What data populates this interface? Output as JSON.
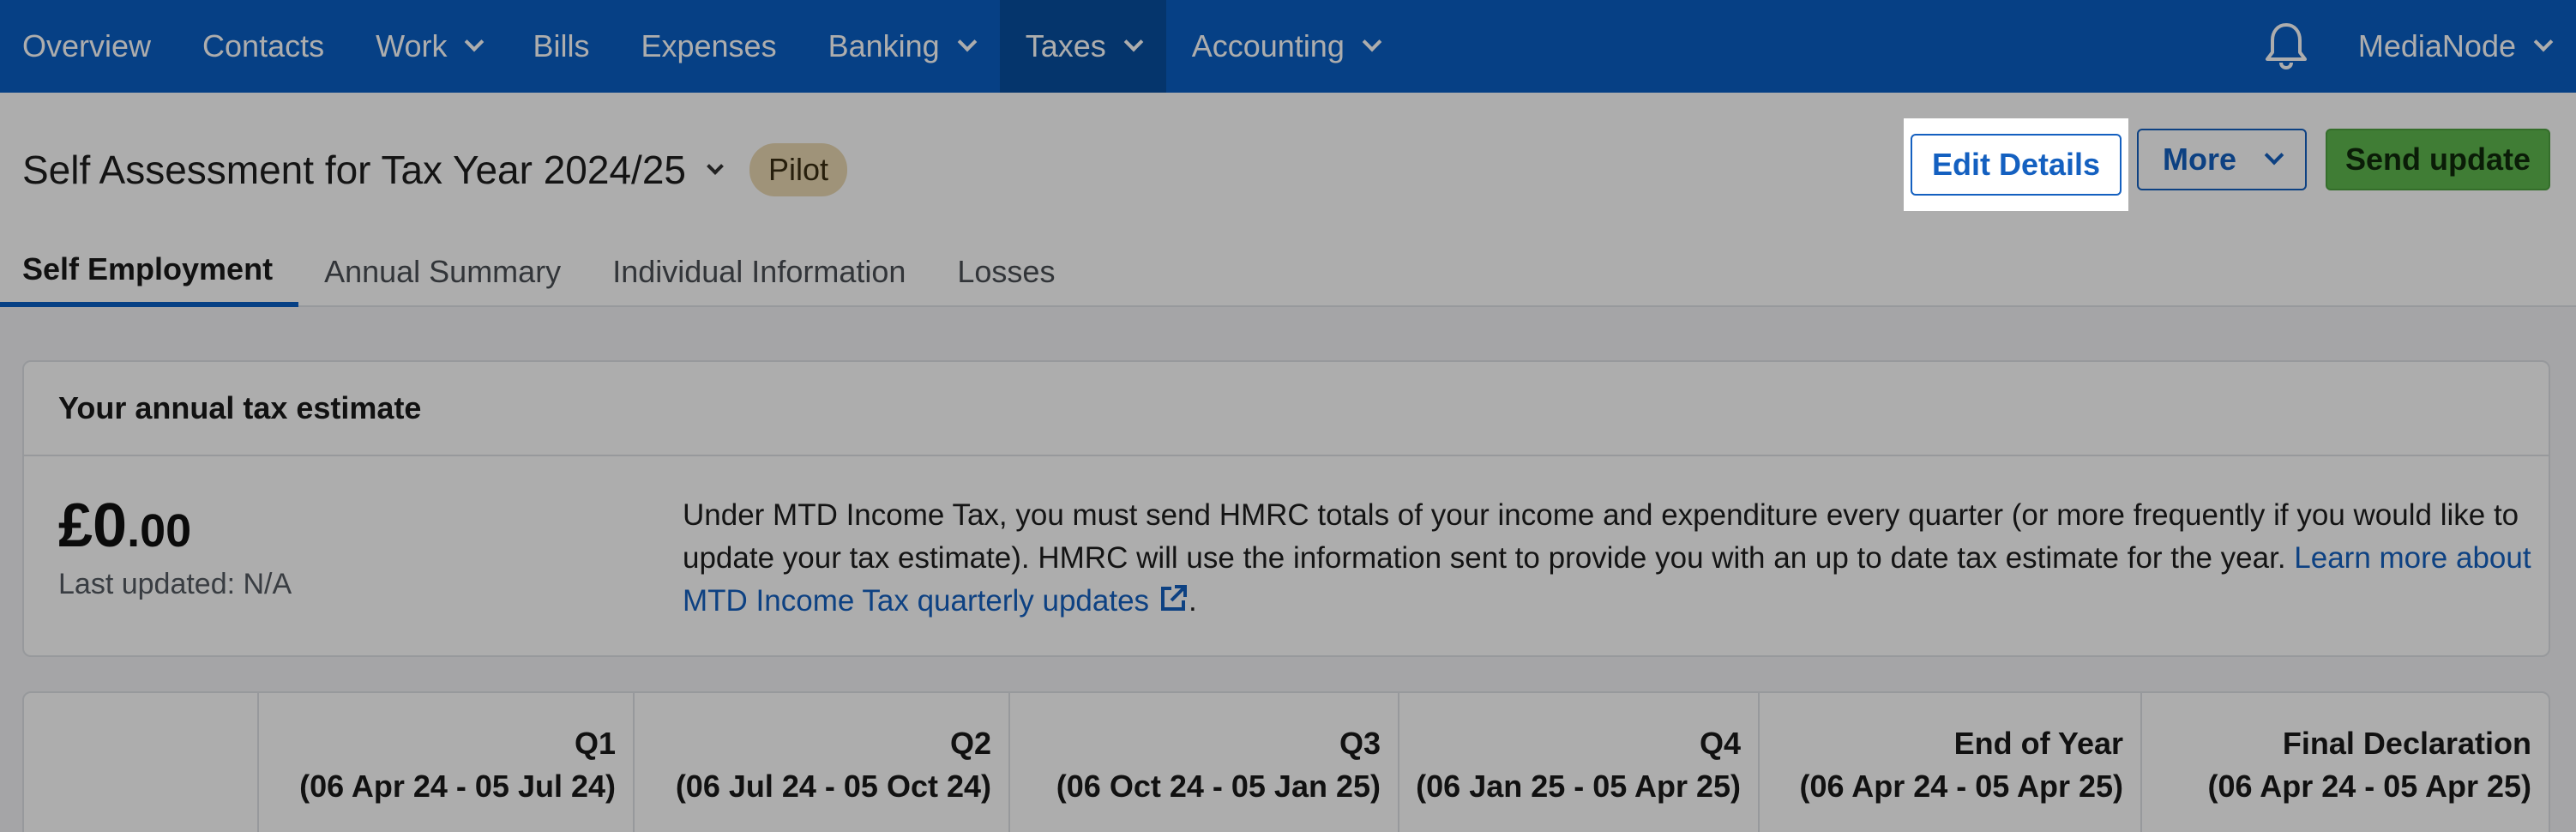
{
  "nav": {
    "items": [
      {
        "label": "Overview",
        "dropdown": false
      },
      {
        "label": "Contacts",
        "dropdown": false
      },
      {
        "label": "Work",
        "dropdown": true
      },
      {
        "label": "Bills",
        "dropdown": false
      },
      {
        "label": "Expenses",
        "dropdown": false
      },
      {
        "label": "Banking",
        "dropdown": true
      },
      {
        "label": "Taxes",
        "dropdown": true
      },
      {
        "label": "Accounting",
        "dropdown": true
      }
    ],
    "active": "Taxes",
    "org_name": "MediaNode",
    "bell_icon": "bell-icon"
  },
  "header": {
    "title": "Self Assessment for Tax Year 2024/25",
    "badge": "Pilot",
    "edit_label": "Edit Details",
    "more_label": "More",
    "send_label": "Send update"
  },
  "tabs": [
    {
      "label": "Self Employment"
    },
    {
      "label": "Annual Summary"
    },
    {
      "label": "Individual Information"
    },
    {
      "label": "Losses"
    }
  ],
  "estimate": {
    "heading": "Your annual tax estimate",
    "amount_main": "£0",
    "amount_pence": ".00",
    "last_updated": "Last updated: N/A",
    "description": "Under MTD Income Tax, you must send HMRC totals of your income and expenditure every quarter (or more frequently if you would like to update your tax estimate). HMRC will use the information sent to provide you with an up to date tax estimate for the year. ",
    "link_text": "Learn more about MTD Income Tax quarterly updates",
    "after_link": "."
  },
  "quarters": [
    {
      "name": "Q1",
      "range": "(06 Apr 24 - 05 Jul 24)"
    },
    {
      "name": "Q2",
      "range": "(06 Jul 24 - 05 Oct 24)"
    },
    {
      "name": "Q3",
      "range": "(06 Oct 24 - 05 Jan 25)"
    },
    {
      "name": "Q4",
      "range": "(06 Jan 25 - 05 Apr 25)"
    },
    {
      "name": "End of Year",
      "range": "(06 Apr 24 - 05 Apr 25)"
    },
    {
      "name": "Final Declaration",
      "range": "(06 Apr 24 - 05 Apr 25)"
    }
  ],
  "colors": {
    "nav_bg": "#0a5fc4",
    "accent": "#1460c0",
    "send_bg": "#5fb84f",
    "badge_bg": "#ead9b3"
  }
}
